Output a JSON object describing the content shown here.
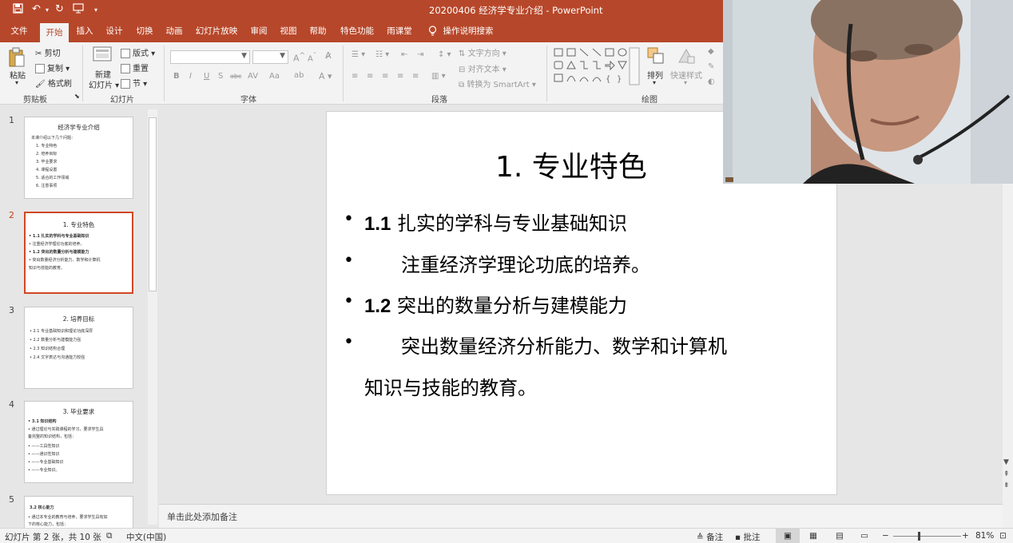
{
  "titlebar": {
    "doc_title": "20200406  经济学专业介绍  -  PowerPoint",
    "save_icon": "save-icon",
    "undo_icon": "undo-icon",
    "redo_icon": "redo-icon"
  },
  "tabs": [
    {
      "label": "文件"
    },
    {
      "label": "开始"
    },
    {
      "label": "插入"
    },
    {
      "label": "设计"
    },
    {
      "label": "切换"
    },
    {
      "label": "动画"
    },
    {
      "label": "幻灯片放映"
    },
    {
      "label": "审阅"
    },
    {
      "label": "视图"
    },
    {
      "label": "帮助"
    },
    {
      "label": "特色功能"
    },
    {
      "label": "雨课堂"
    },
    {
      "label": "操作说明搜索"
    }
  ],
  "ribbon": {
    "clipboard": {
      "paste": "粘贴",
      "cut": "剪切",
      "copy": "复制",
      "format_painter": "格式刷",
      "group_label": "剪贴板"
    },
    "slides": {
      "new_slide_1": "新建",
      "new_slide_2": "幻灯片",
      "layout": "版式",
      "reset": "重置",
      "section": "节",
      "group_label": "幻灯片"
    },
    "font": {
      "group_label": "字体",
      "bold": "B",
      "italic": "I",
      "underline": "U",
      "shadow": "S",
      "strike": "abc",
      "spacing": "AV",
      "case": "Aa"
    },
    "paragraph": {
      "text_direction": "文字方向",
      "align_text": "对齐文本",
      "smartart": "转换为 SmartArt",
      "group_label": "段落"
    },
    "drawing": {
      "arrange": "排列",
      "quick_styles": "快速样式",
      "group_label": "绘图"
    }
  },
  "thumbnails": [
    {
      "number": "1",
      "title": "经济学专业介绍",
      "lines": [
        "本课介绍以下几个问题：",
        "1. 专业特色",
        "2. 培养目标",
        "3. 毕业要求",
        "4. 课程设置",
        "5. 适合的工作领域",
        "6. 注意事项"
      ]
    },
    {
      "number": "2",
      "title": "1.  专业特色",
      "lines": [
        "• 1.1 扎实的学科与专业基础知识",
        "•      注重经济学理论功底的培养。",
        "• 1.2 突出的数量分析与建模能力",
        "•      突出数量经济分析能力、数学和计算机",
        "   知识与技能的教育。"
      ]
    },
    {
      "number": "3",
      "title": "2.  培养目标",
      "lines": [
        "• 2.1 专业基础知识和理论功底深厚",
        "• 2.2 数量分析与建模能力强",
        "• 2.3 知识结构合理",
        "• 2.4 文字表达与沟通能力较强"
      ]
    },
    {
      "number": "4",
      "title": "3.  毕业要求",
      "lines": [
        "• 3.1  知识结构",
        "•      通过理论与实践课程的学习，要求学生具",
        "   备完整的知识结构，包括：",
        "• ——工具性知识",
        "• ——通识性知识",
        "• ——专业基础知识",
        "• ——专业知识。"
      ]
    },
    {
      "number": "5",
      "title": "3.2 核心能力",
      "lines": [
        "• 通过本专业的教育与培养，要求学生具有如",
        "   下的核心能力，包括："
      ]
    }
  ],
  "slide": {
    "title": "1.  专业特色",
    "bullets": [
      {
        "num": "1.1",
        "text": "  扎实的学科与专业基础知识"
      },
      {
        "num": "",
        "text": "注重经济学理论功底的培养。"
      },
      {
        "num": "1.2",
        "text": " 突出的数量分析与建模能力"
      },
      {
        "num": "",
        "text": "突出数量经济分析能力、数学和计算机"
      }
    ],
    "continuation": "知识与技能的教育。"
  },
  "notes": {
    "placeholder": "单击此处添加备注"
  },
  "statusbar": {
    "slide_info": "幻灯片 第 2 张，共 10 张",
    "language": "中文(中国)",
    "notes_btn": "备注",
    "comments_btn": "批注",
    "zoom": "81%"
  }
}
